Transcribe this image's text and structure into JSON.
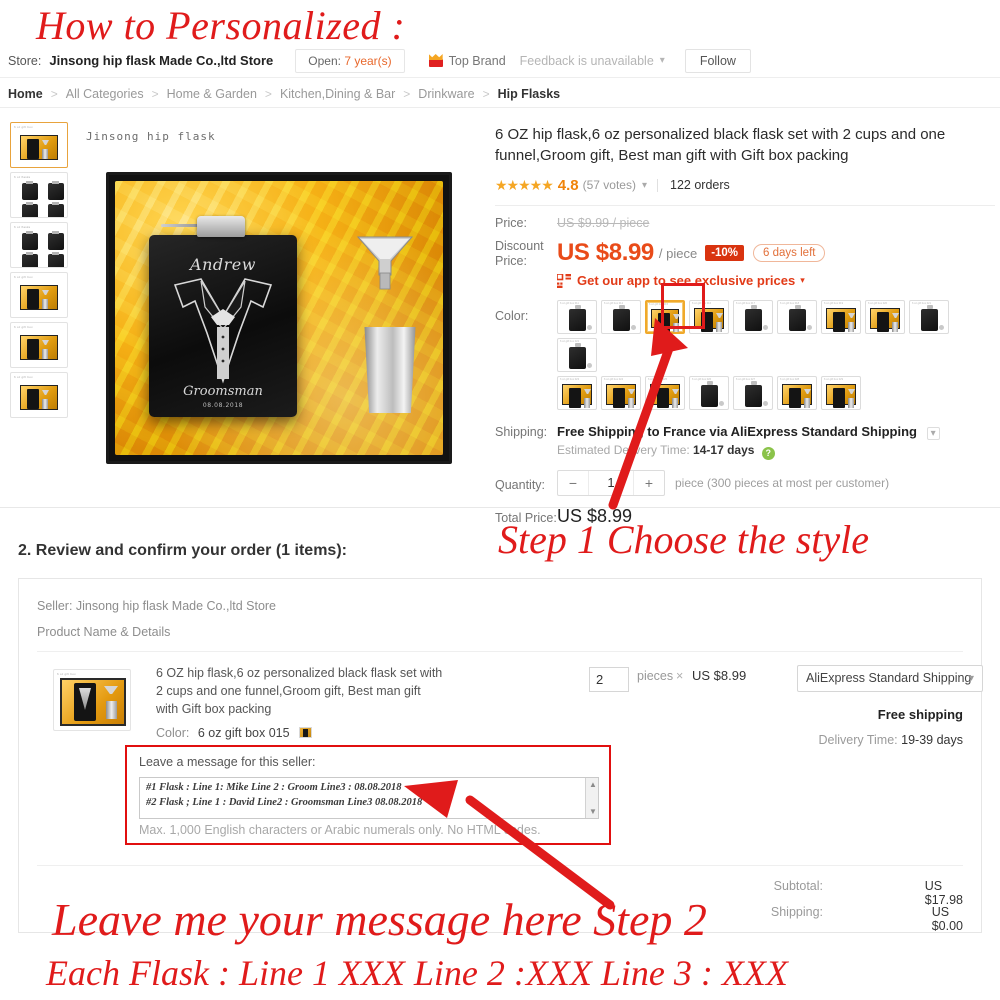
{
  "store_header": {
    "store_label": "Store:",
    "store_name": "Jinsong hip flask Made Co.,ltd Store",
    "open_prefix": "Open:",
    "open_years": "7 year(s)",
    "top_brand": "Top Brand",
    "feedback": "Feedback is unavailable",
    "follow": "Follow"
  },
  "breadcrumb": [
    "Home",
    "All Categories",
    "Home & Garden",
    "Kitchen,Dining & Bar",
    "Drinkware",
    "Hip Flasks"
  ],
  "product": {
    "title": "6 OZ hip flask,6 oz personalized black flask set with 2 cups and one funnel,Groom gift, Best man gift with Gift box packing",
    "stars": "★★★★★",
    "rating": "4.8",
    "votes": "(57 votes)",
    "orders": "122 orders",
    "watermark": "Jinsong  hip  flask",
    "engraved_name": "Andrew",
    "engraved_role": "Groomsman",
    "engraved_date": "08.08.2018",
    "price_label": "Price:",
    "old_price": "US $9.99 / piece",
    "discount_label_line1": "Discount",
    "discount_label_line2": "Price:",
    "price": "US $8.99",
    "price_unit": "/ piece",
    "discount_badge": "-10%",
    "days_left": "6 days left",
    "app_promo": "Get our app to see exclusive prices",
    "color_label": "Color:",
    "shipping_label": "Shipping:",
    "shipping_value": "Free Shipping to France via AliExpress Standard Shipping",
    "delivery_label": "Estimated Delivery Time:",
    "delivery_value": "14-17 days",
    "quantity_label": "Quantity:",
    "quantity_value": "1",
    "quantity_minus": "−",
    "quantity_plus": "+",
    "quantity_note": "piece (300 pieces at most per customer)",
    "total_label": "Total Price:",
    "total_value": "US $8.99"
  },
  "swatches": {
    "row1": [
      {
        "label": "6 oz gift box 011",
        "kind": "flask"
      },
      {
        "label": "6 oz gift box 012",
        "kind": "flask"
      },
      {
        "label": "6 oz gift box 015",
        "kind": "box",
        "selected": true
      },
      {
        "label": "6 oz gift box 016",
        "kind": "box"
      },
      {
        "label": "6 oz gift box 017",
        "kind": "flask"
      },
      {
        "label": "6 oz gift box 018",
        "kind": "flask"
      },
      {
        "label": "6 oz gift box 019",
        "kind": "box"
      },
      {
        "label": "6 oz gift box 020",
        "kind": "box"
      },
      {
        "label": "6 oz gift box 021",
        "kind": "flask"
      },
      {
        "label": "6 oz gift box 022",
        "kind": "flask"
      }
    ],
    "row2": [
      {
        "label": "6 oz gift box 023",
        "kind": "box"
      },
      {
        "label": "6 oz gift box 024",
        "kind": "box"
      },
      {
        "label": "6 oz gift box 025",
        "kind": "box"
      },
      {
        "label": "6 oz gift box 026",
        "kind": "flask"
      },
      {
        "label": "6 oz gift box 027",
        "kind": "flask"
      },
      {
        "label": "6 oz gift box 028",
        "kind": "box"
      },
      {
        "label": "6 oz gift box 029",
        "kind": "box"
      }
    ]
  },
  "thumbnails": [
    {
      "label": "6 oz gift box",
      "kind": "box"
    },
    {
      "label": "6 oz flasks",
      "kind": "quad"
    },
    {
      "label": "6 oz flasks",
      "kind": "quad"
    },
    {
      "label": "6 oz gift box",
      "kind": "box"
    },
    {
      "label": "6 oz gift box",
      "kind": "box"
    },
    {
      "label": "6 oz gift box",
      "kind": "box"
    }
  ],
  "order_section": {
    "heading": "2. Review and confirm your order (1 items):",
    "seller": "Seller: Jinsong hip flask Made Co.,ltd Store",
    "product_name_details": "Product Name & Details",
    "item_name": "6 OZ hip flask,6 oz personalized black flask set with 2 cups and one funnel,Groom gift, Best man gift with Gift box packing",
    "color_label": "Color:",
    "color_value": "6 oz gift box 015",
    "qty_value": "2",
    "pieces": "pieces",
    "times": "×",
    "unit_price": "US $8.99",
    "shipping_method": "AliExpress Standard Shipping",
    "free_shipping": "Free shipping",
    "delivery_time_label": "Delivery Time:",
    "delivery_time_value": "19-39 days",
    "message_label": "Leave a message for this seller:",
    "message_line1": "#1 Flask : Line 1: Mike Line 2 : Groom Line3 : 08.08.2018",
    "message_line2": "#2 Flask ; Line 1 : David Line2 : Groomsman Line3 08.08.2018",
    "message_hint": "Max. 1,000 English characters or Arabic numerals only. No HTML codes.",
    "subtotal_label": "Subtotal:",
    "subtotal_value": "US $17.98",
    "shipping_label": "Shipping:",
    "shipping_value": "US $0.00"
  },
  "annotations": {
    "how_to": "How to Personalized :",
    "step1": "Step  1 Choose the style",
    "step2": "Leave me your message here Step 2",
    "each_flask": "Each Flask : Line 1  XXX   Line 2 :XXX Line 3 : XXX",
    "color": "#e01b1b"
  }
}
